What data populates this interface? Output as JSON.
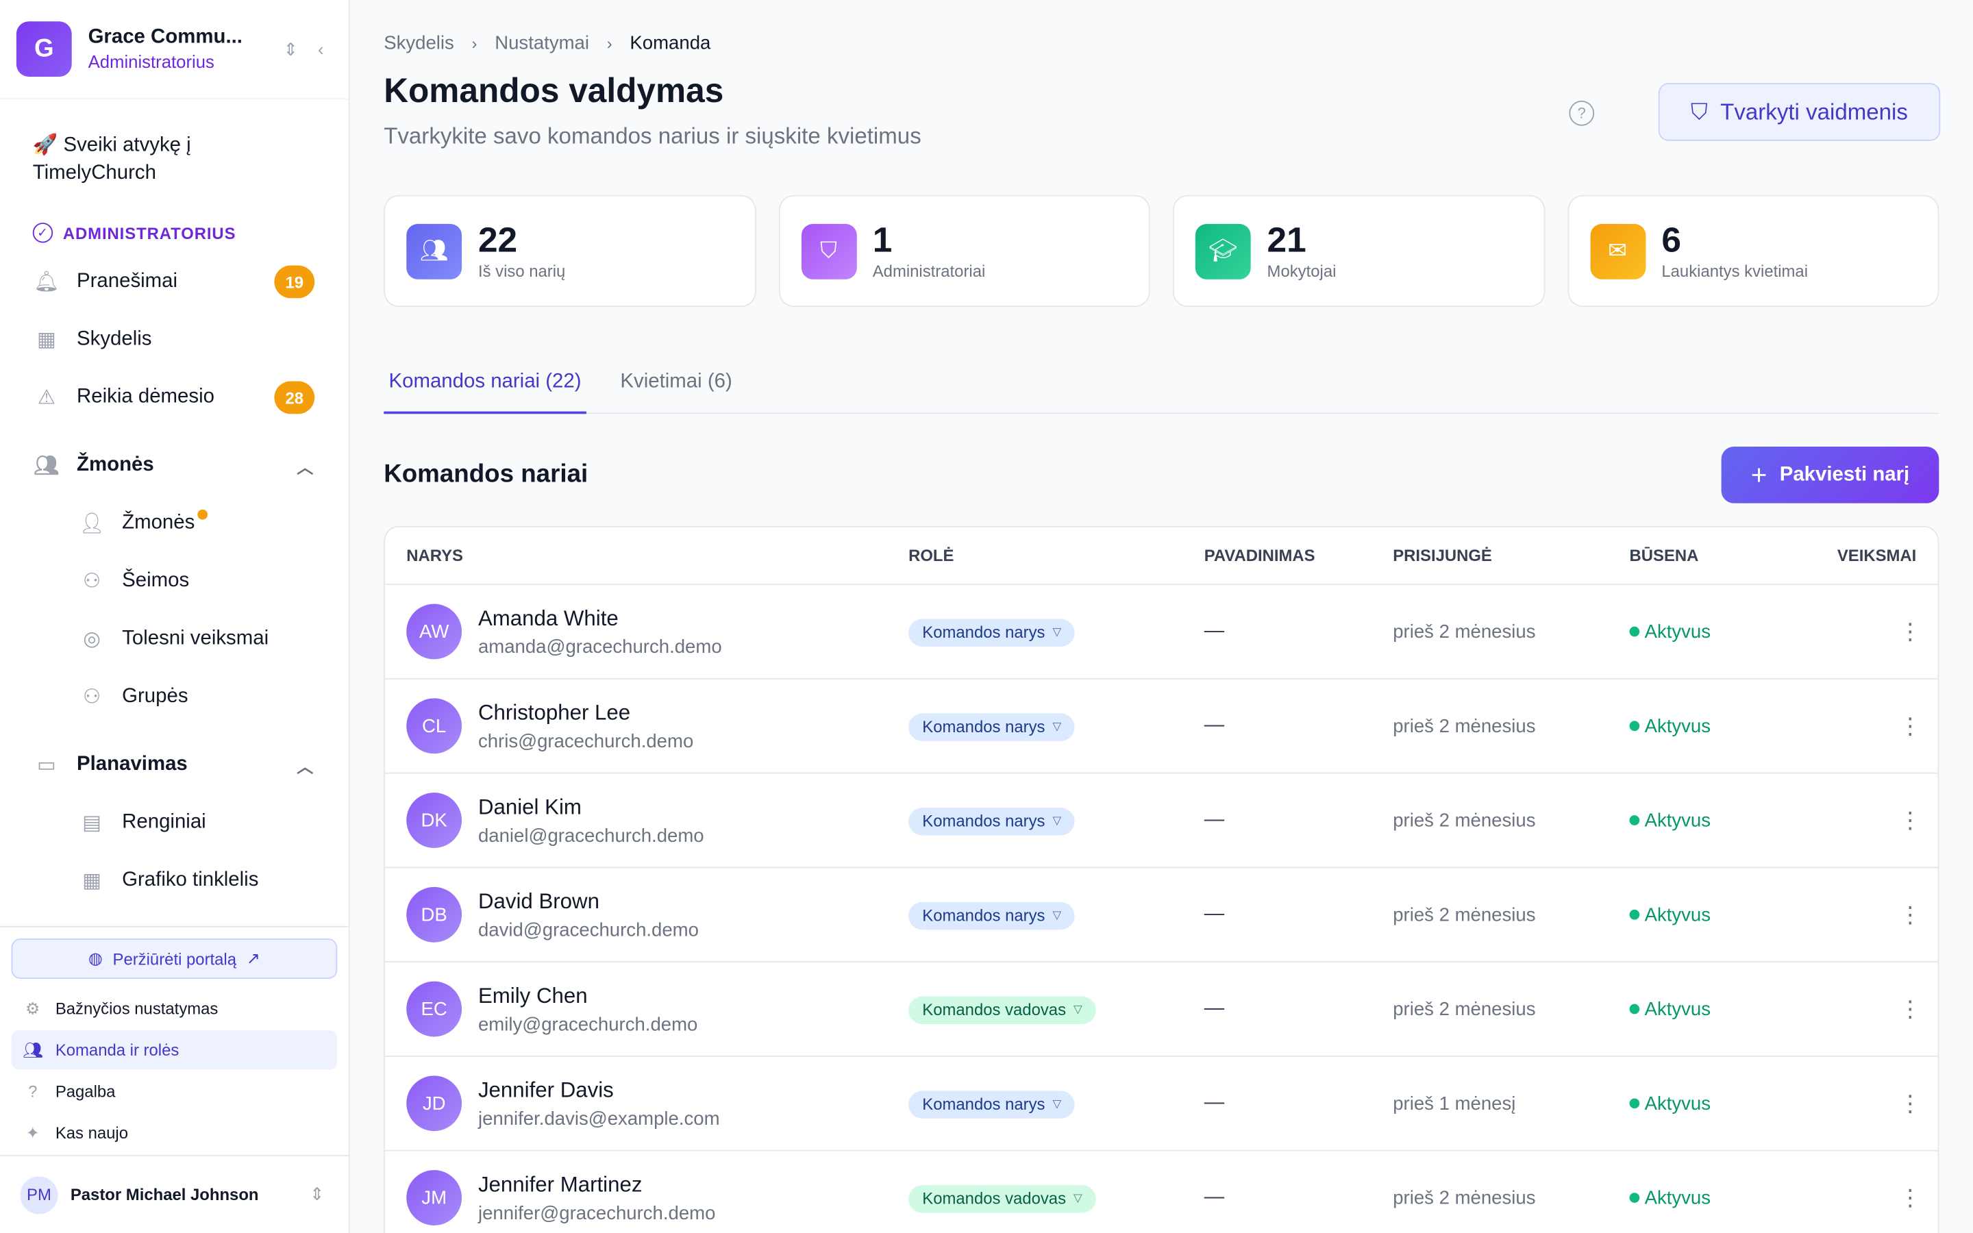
{
  "org": {
    "initial": "G",
    "name": "Grace Commu...",
    "role": "Administratorius"
  },
  "welcome": "🚀 Sveiki atvykę į TimelyChurch",
  "admin_label": "ADMINISTRATORIUS",
  "nav": {
    "notifications": {
      "label": "Pranešimai",
      "badge": "19"
    },
    "dashboard": {
      "label": "Skydelis"
    },
    "attention": {
      "label": "Reikia dėmesio",
      "badge": "28"
    },
    "people_group": "Žmonės",
    "people": "Žmonės",
    "families": "Šeimos",
    "followups": "Tolesni veiksmai",
    "groups": "Grupės",
    "planning_group": "Planavimas",
    "events": "Renginiai",
    "schedule_grid": "Grafiko tinklelis"
  },
  "bottom": {
    "portal": "Peržiūrėti portalą",
    "church_settings": "Bažnyčios nustatymas",
    "team_roles": "Komanda ir rolės",
    "help": "Pagalba",
    "whats_new": "Kas naujo"
  },
  "user": {
    "initials": "PM",
    "name": "Pastor Michael Johnson"
  },
  "breadcrumb": [
    "Skydelis",
    "Nustatymai",
    "Komanda"
  ],
  "page": {
    "title": "Komandos valdymas",
    "subtitle": "Tvarkykite savo komandos narius ir siųskite kvietimus",
    "roles_button": "Tvarkyti vaidmenis"
  },
  "stats": [
    {
      "value": "22",
      "label": "Iš viso narių",
      "color": "#6366f1"
    },
    {
      "value": "1",
      "label": "Administratoriai",
      "color": "#a855f7"
    },
    {
      "value": "21",
      "label": "Mokytojai",
      "color": "#10b981"
    },
    {
      "value": "6",
      "label": "Laukiantys kvietimai",
      "color": "#f59e0b"
    }
  ],
  "tabs": [
    "Komandos nariai (22)",
    "Kvietimai (6)"
  ],
  "section": {
    "title": "Komandos nariai",
    "invite_button": "Pakviesti narį"
  },
  "columns": [
    "NARYS",
    "ROLĖ",
    "PAVADINIMAS",
    "PRISIJUNGĖ",
    "BŪSENA",
    "VEIKSMAI"
  ],
  "members": [
    {
      "initials": "AW",
      "name": "Amanda White",
      "email": "amanda@gracechurch.demo",
      "role": "Komandos narys",
      "title": "—",
      "joined": "prieš 2 mėnesius",
      "status": "Aktyvus"
    },
    {
      "initials": "CL",
      "name": "Christopher Lee",
      "email": "chris@gracechurch.demo",
      "role": "Komandos narys",
      "title": "—",
      "joined": "prieš 2 mėnesius",
      "status": "Aktyvus"
    },
    {
      "initials": "DK",
      "name": "Daniel Kim",
      "email": "daniel@gracechurch.demo",
      "role": "Komandos narys",
      "title": "—",
      "joined": "prieš 2 mėnesius",
      "status": "Aktyvus"
    },
    {
      "initials": "DB",
      "name": "David Brown",
      "email": "david@gracechurch.demo",
      "role": "Komandos narys",
      "title": "—",
      "joined": "prieš 2 mėnesius",
      "status": "Aktyvus"
    },
    {
      "initials": "EC",
      "name": "Emily Chen",
      "email": "emily@gracechurch.demo",
      "role": "Komandos vadovas",
      "title": "—",
      "joined": "prieš 2 mėnesius",
      "status": "Aktyvus"
    },
    {
      "initials": "JD",
      "name": "Jennifer Davis",
      "email": "jennifer.davis@example.com",
      "role": "Komandos narys",
      "title": "—",
      "joined": "prieš 1 mėnesį",
      "status": "Aktyvus"
    },
    {
      "initials": "JM",
      "name": "Jennifer Martinez",
      "email": "jennifer@gracechurch.demo",
      "role": "Komandos vadovas",
      "title": "—",
      "joined": "prieš 2 mėnesius",
      "status": "Aktyvus"
    }
  ]
}
